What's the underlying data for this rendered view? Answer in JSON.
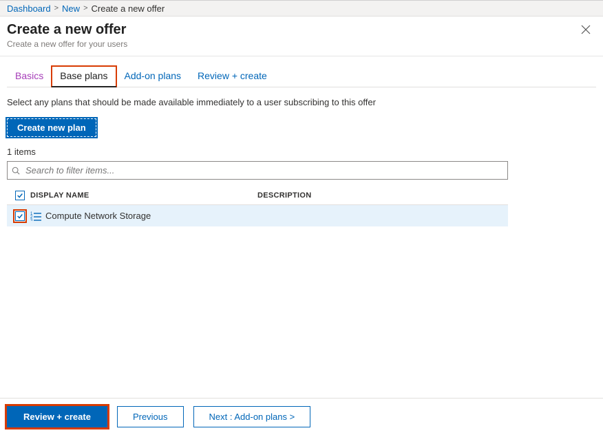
{
  "breadcrumb": {
    "items": [
      "Dashboard",
      "New"
    ],
    "current": "Create a new offer"
  },
  "header": {
    "title": "Create a new offer",
    "subtitle": "Create a new offer for your users"
  },
  "tabs": {
    "basics": "Basics",
    "base_plans": "Base plans",
    "addon_plans": "Add-on plans",
    "review": "Review + create"
  },
  "body": {
    "instruction": "Select any plans that should be made available immediately to a user subscribing to this offer",
    "create_plan_label": "Create new plan",
    "items_count": "1 items",
    "search_placeholder": "Search to filter items..."
  },
  "table": {
    "col_name": "DISPLAY NAME",
    "col_desc": "DESCRIPTION",
    "rows": [
      {
        "name": "Compute Network Storage",
        "description": "",
        "checked": true
      }
    ]
  },
  "footer": {
    "review_create": "Review + create",
    "previous": "Previous",
    "next": "Next : Add-on plans >"
  }
}
